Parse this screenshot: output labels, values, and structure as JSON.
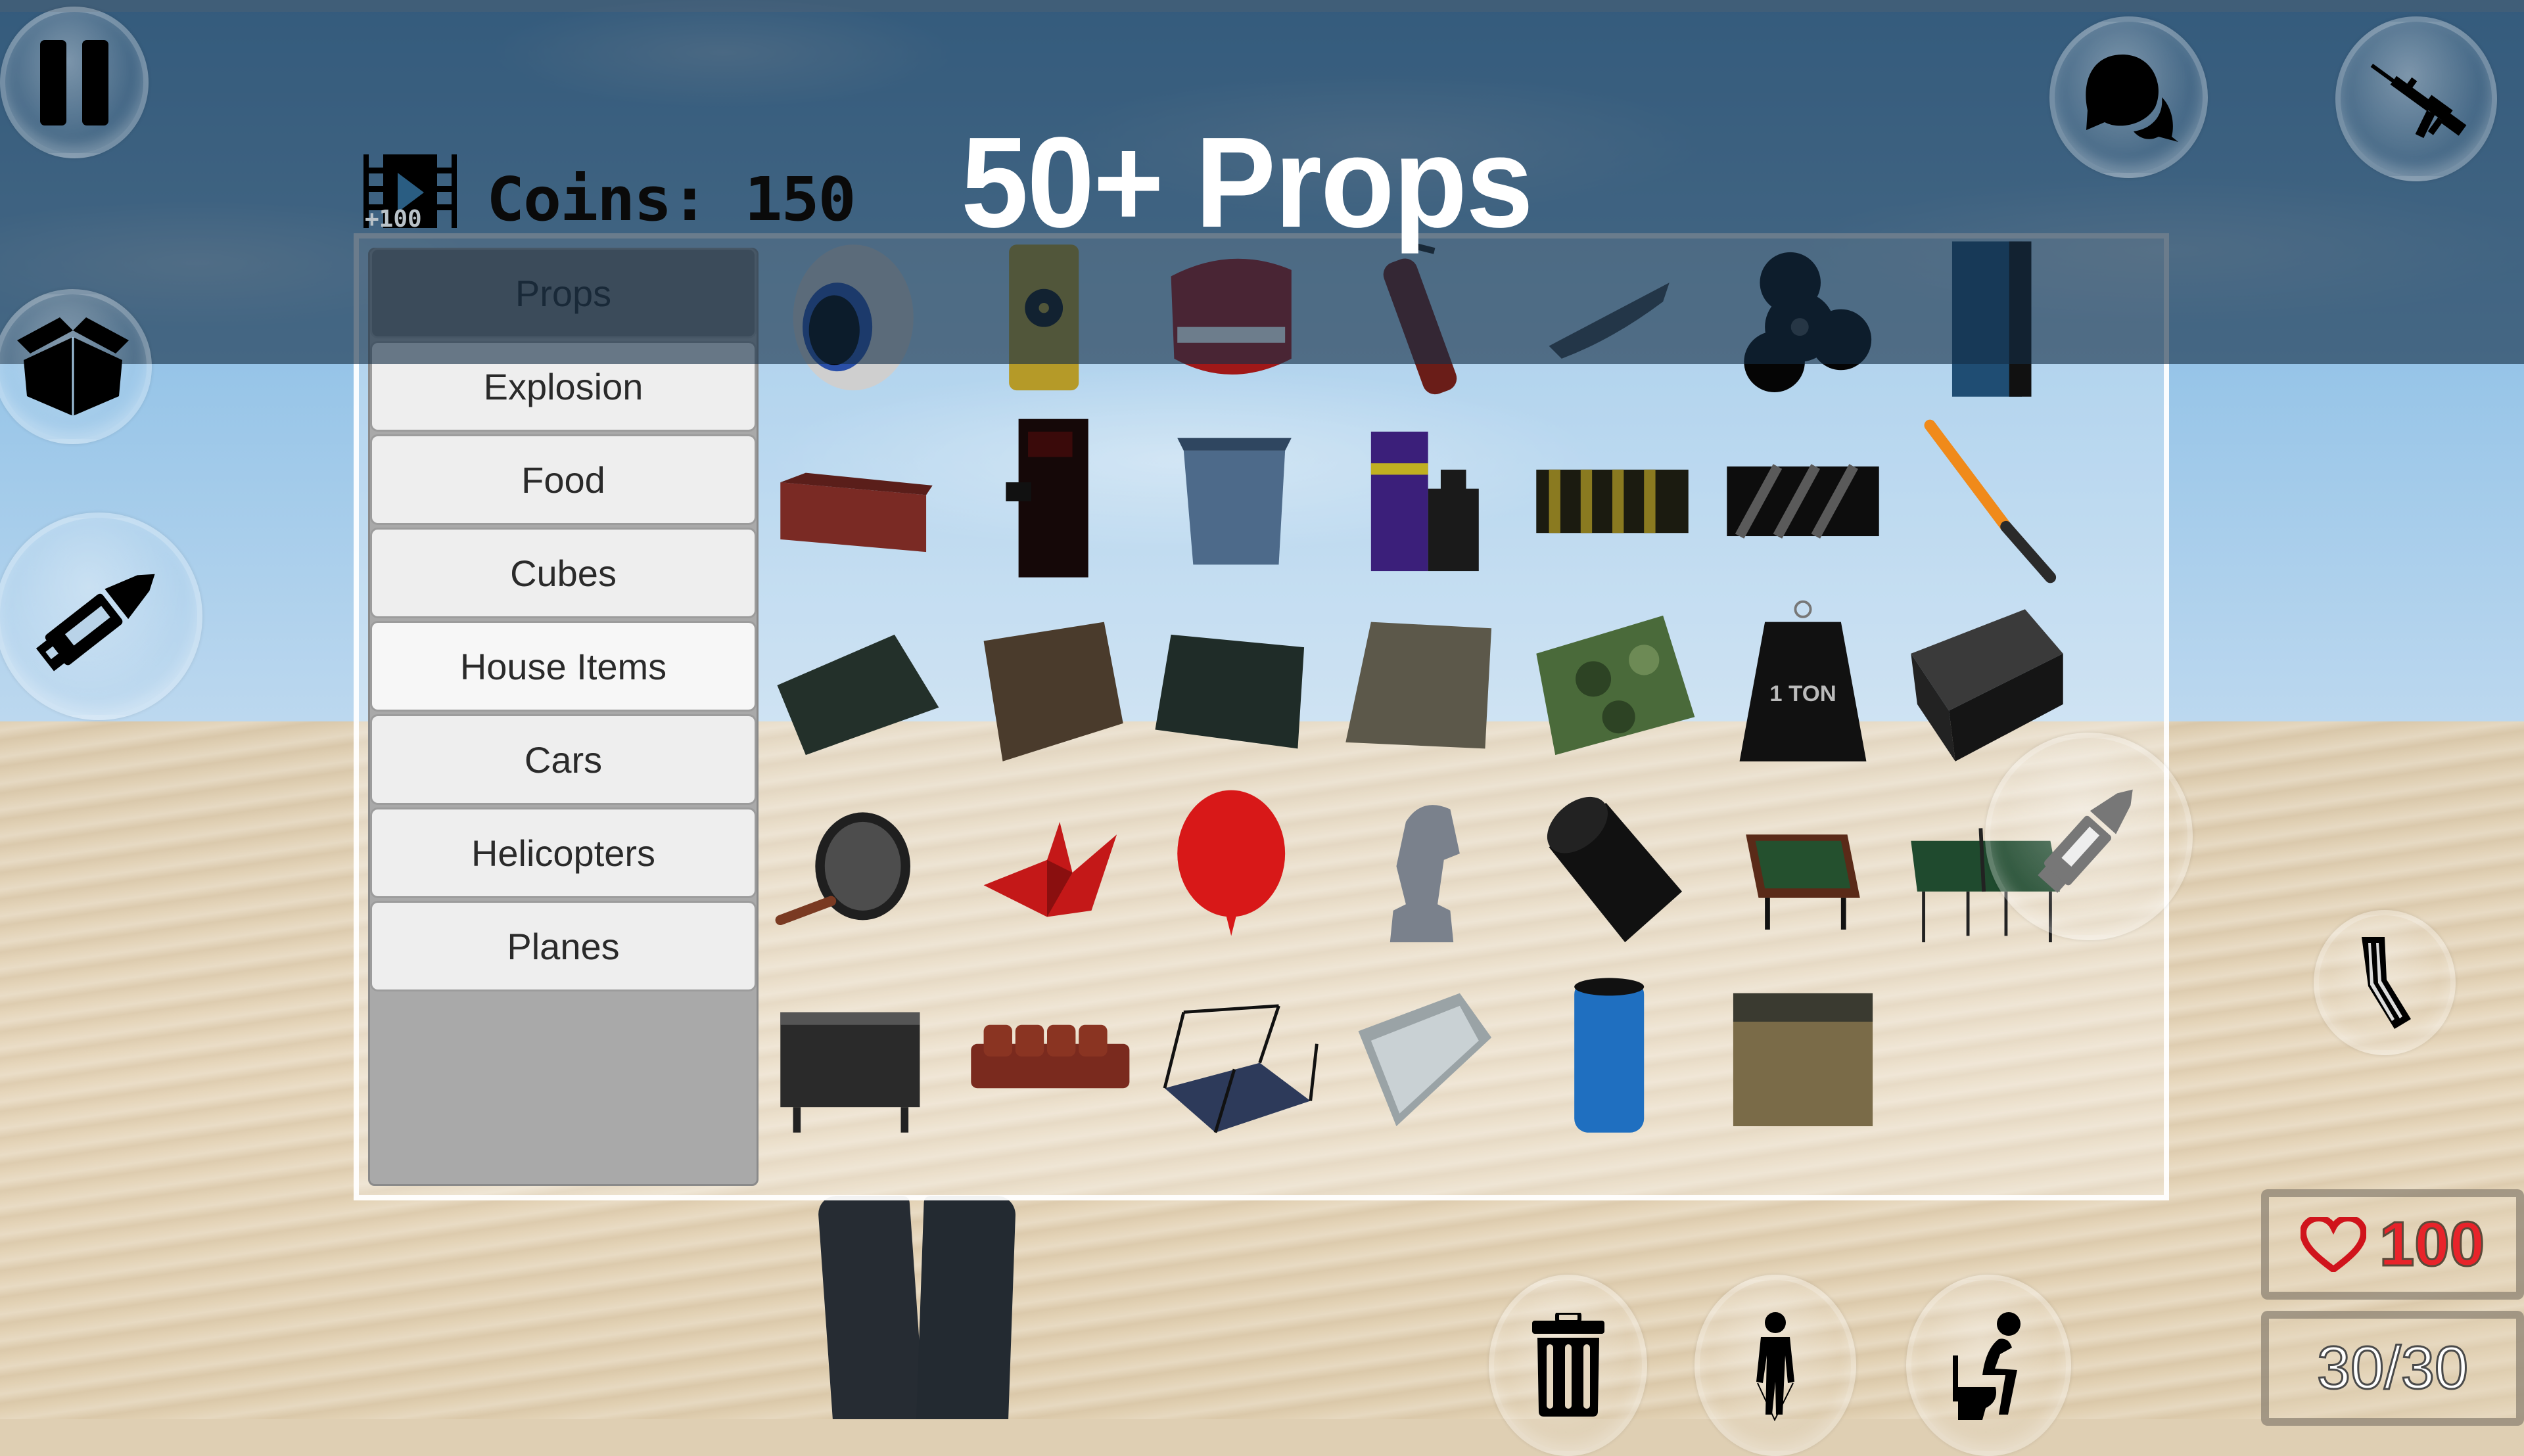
{
  "headline": "50+ Props",
  "currency": {
    "label": "Coins: 150",
    "value": 150,
    "reward_badge": "+100",
    "reward_icon": "film-play-icon"
  },
  "categories": [
    {
      "label": "Props",
      "state": "selected"
    },
    {
      "label": "Explosion",
      "state": "normal"
    },
    {
      "label": "Food",
      "state": "normal"
    },
    {
      "label": "Cubes",
      "state": "normal"
    },
    {
      "label": "House Items",
      "state": "hover"
    },
    {
      "label": "Cars",
      "state": "normal"
    },
    {
      "label": "Helicopters",
      "state": "normal"
    },
    {
      "label": "Planes",
      "state": "normal"
    }
  ],
  "props": [
    [
      "eyeball",
      "radiation-barrel",
      "chattering-teeth",
      "fire-extinguisher",
      "rowboat",
      "fidget-spinner",
      "vending-machine"
    ],
    [
      "shipping-container",
      "arcade-cabinet",
      "dumpster",
      "arcade-racer",
      "hazard-barrier",
      "striped-barrier",
      "baseball-bat"
    ],
    [
      "dark-mat",
      "brown-mat",
      "green-mat",
      "gray-mat",
      "camo-mat",
      "one-ton-weight",
      "cinder-block"
    ],
    [
      "frying-pan",
      "origami-crane",
      "red-balloon",
      "chess-knight",
      "trash-can-tipped",
      "pool-table",
      "ping-pong-table"
    ],
    [
      "grill",
      "red-sofa",
      "bridge-section",
      "display-case",
      "blue-barrel",
      "crate-dumpster"
    ]
  ],
  "one_ton_label": "1 TON",
  "hud": {
    "health": "100",
    "ammo": "30/30",
    "health_color": "#e8232a"
  },
  "buttons": {
    "pause": "pause-icon",
    "spawn_box": "open-box-icon",
    "weapon_ammo": "bullet-icon",
    "chat": "chat-bubbles-icon",
    "weapon": "rifle-icon",
    "fire": "bullet-icon",
    "reload": "magazine-icon",
    "delete": "trash-icon",
    "jump": "jump-rope-icon",
    "toilet": "toilet-icon"
  }
}
